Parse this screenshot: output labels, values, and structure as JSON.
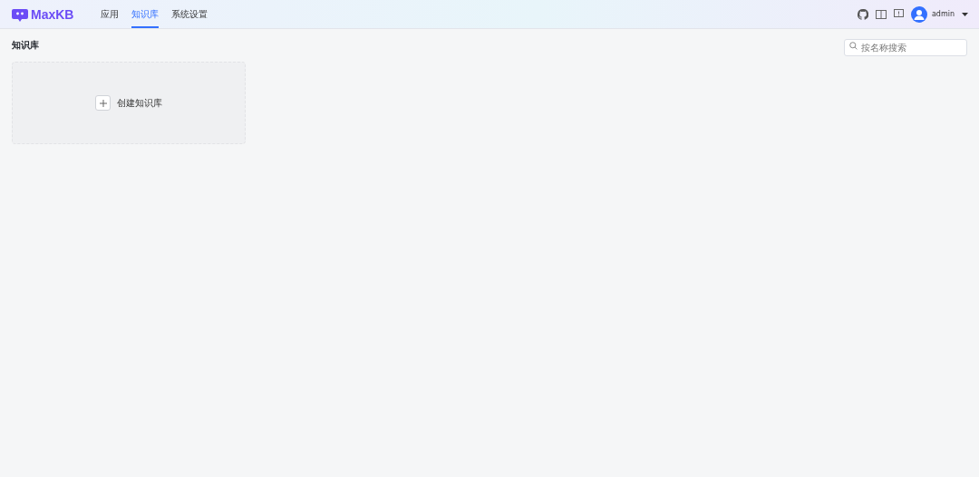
{
  "header": {
    "logo": "MaxKB",
    "nav": [
      {
        "label": "应用",
        "selected": false
      },
      {
        "label": "知识库",
        "selected": true
      },
      {
        "label": "系统设置",
        "selected": false
      }
    ],
    "user": "admin"
  },
  "page": {
    "title": "知识库",
    "search": {
      "placeholder": "按名称搜索"
    },
    "create_card": {
      "label": "创建知识库"
    }
  }
}
